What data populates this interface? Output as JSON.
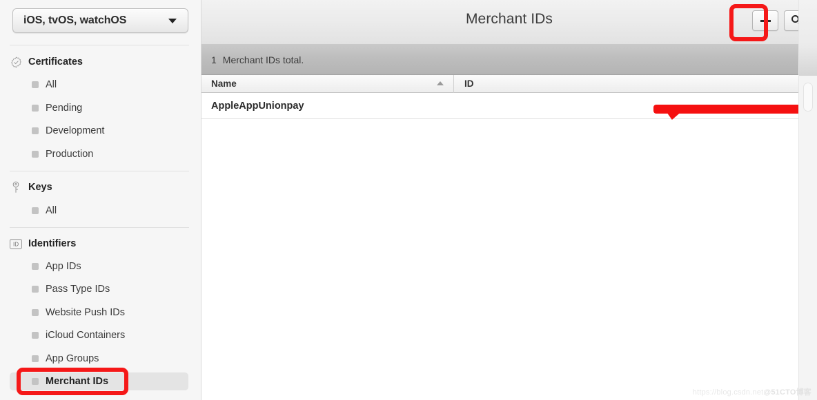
{
  "sidebar": {
    "platform_select": {
      "value": "iOS, tvOS, watchOS",
      "caret_icon": "chevron-down-icon"
    },
    "groups": [
      {
        "id": "certificates",
        "label": "Certificates",
        "icon": "certificate-seal-icon",
        "items": [
          {
            "label": "All",
            "selected": false
          },
          {
            "label": "Pending",
            "selected": false
          },
          {
            "label": "Development",
            "selected": false
          },
          {
            "label": "Production",
            "selected": false
          }
        ]
      },
      {
        "id": "keys",
        "label": "Keys",
        "icon": "key-icon",
        "items": [
          {
            "label": "All",
            "selected": false
          }
        ]
      },
      {
        "id": "identifiers",
        "label": "Identifiers",
        "icon": "id-badge-icon",
        "items": [
          {
            "label": "App IDs",
            "selected": false
          },
          {
            "label": "Pass Type IDs",
            "selected": false
          },
          {
            "label": "Website Push IDs",
            "selected": false
          },
          {
            "label": "iCloud Containers",
            "selected": false
          },
          {
            "label": "App Groups",
            "selected": false
          },
          {
            "label": "Merchant IDs",
            "selected": true
          }
        ]
      }
    ]
  },
  "toolbar": {
    "title": "Merchant IDs",
    "add_button": {
      "icon": "plus-icon",
      "label": ""
    },
    "search_button": {
      "icon": "search-icon",
      "label": ""
    }
  },
  "count_bar": {
    "count": "1",
    "text": "Merchant IDs total."
  },
  "table": {
    "columns": [
      {
        "key": "name",
        "label": "Name",
        "sorted": true,
        "sort_direction": "ascending",
        "sort_icon": "caret-up-icon"
      },
      {
        "key": "id",
        "label": "ID",
        "sorted": false
      }
    ],
    "rows": [
      {
        "name": "AppleAppUnionpay",
        "id": ""
      }
    ]
  },
  "annotations": {
    "accent_color": "#f51818",
    "highlight_add_button": true,
    "highlight_merchant_ids_item": true,
    "redaction_color": "#f51010"
  },
  "watermark": {
    "url_text": "https://blog.csdn.net",
    "site_text": "@51CTO博客"
  }
}
